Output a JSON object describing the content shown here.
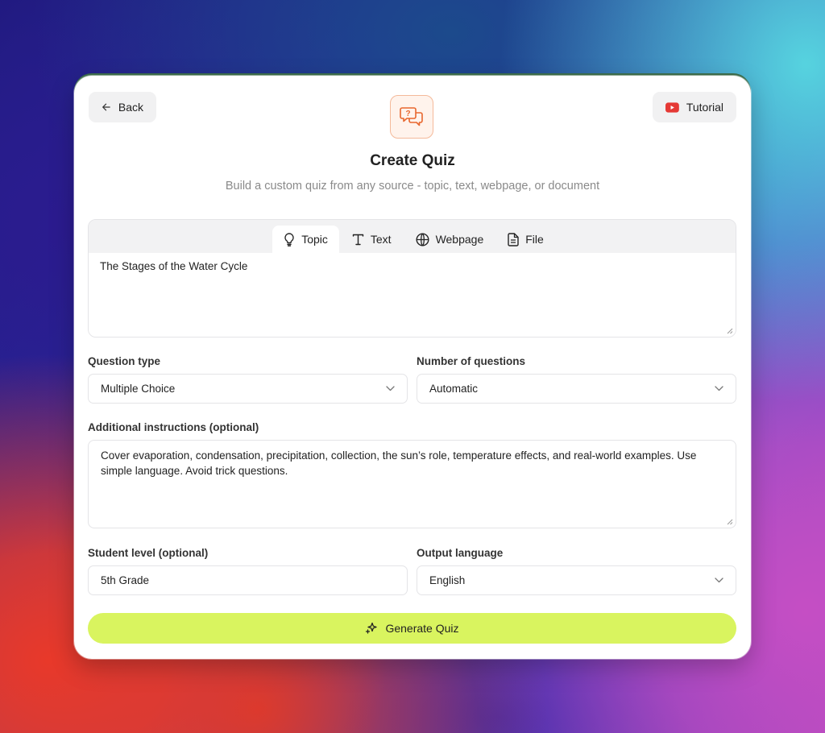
{
  "header": {
    "back_label": "Back",
    "tutorial_label": "Tutorial",
    "title": "Create Quiz",
    "subtitle": "Build a custom quiz from any source - topic, text, webpage, or document"
  },
  "source_tabs": [
    {
      "label": "Topic",
      "icon": "lightbulb-icon",
      "active": true
    },
    {
      "label": "Text",
      "icon": "text-icon",
      "active": false
    },
    {
      "label": "Webpage",
      "icon": "globe-icon",
      "active": false
    },
    {
      "label": "File",
      "icon": "file-icon",
      "active": false
    }
  ],
  "source_input": {
    "value": "The Stages of the Water Cycle"
  },
  "question_type": {
    "label": "Question type",
    "value": "Multiple Choice"
  },
  "num_questions": {
    "label": "Number of questions",
    "value": "Automatic"
  },
  "additional_instructions": {
    "label": "Additional instructions (optional)",
    "value": "Cover evaporation, condensation, precipitation, collection, the sun’s role, temperature effects, and real-world examples. Use simple language. Avoid trick questions."
  },
  "student_level": {
    "label": "Student level (optional)",
    "value": "5th Grade"
  },
  "output_language": {
    "label": "Output language",
    "value": "English"
  },
  "generate_label": "Generate Quiz",
  "colors": {
    "accent": "#d9f45f",
    "logo_orange": "#e8672e",
    "youtube_red": "#e53935"
  }
}
